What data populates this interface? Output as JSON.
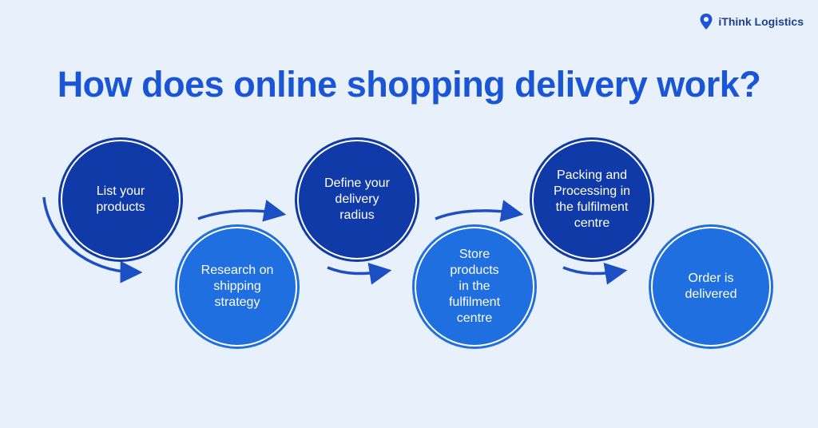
{
  "brand": {
    "name": "iThink Logistics",
    "icon": "location-pin-icon"
  },
  "title": "How does online shopping delivery work?",
  "steps": [
    {
      "label": "List your\nproducts"
    },
    {
      "label": "Research on\nshipping\nstrategy"
    },
    {
      "label": "Define your\ndelivery\nradius"
    },
    {
      "label": "Store\nproducts\nin the\nfulfilment\ncentre"
    },
    {
      "label": "Packing and\nProcessing in\nthe fulfilment\ncentre"
    },
    {
      "label": "Order is\ndelivered"
    }
  ],
  "colors": {
    "background": "#e8f1fb",
    "title": "#1a55d6",
    "dark_circle": "#0f3aa8",
    "light_circle": "#1f6fe0",
    "arrow": "#1d4fc4"
  }
}
